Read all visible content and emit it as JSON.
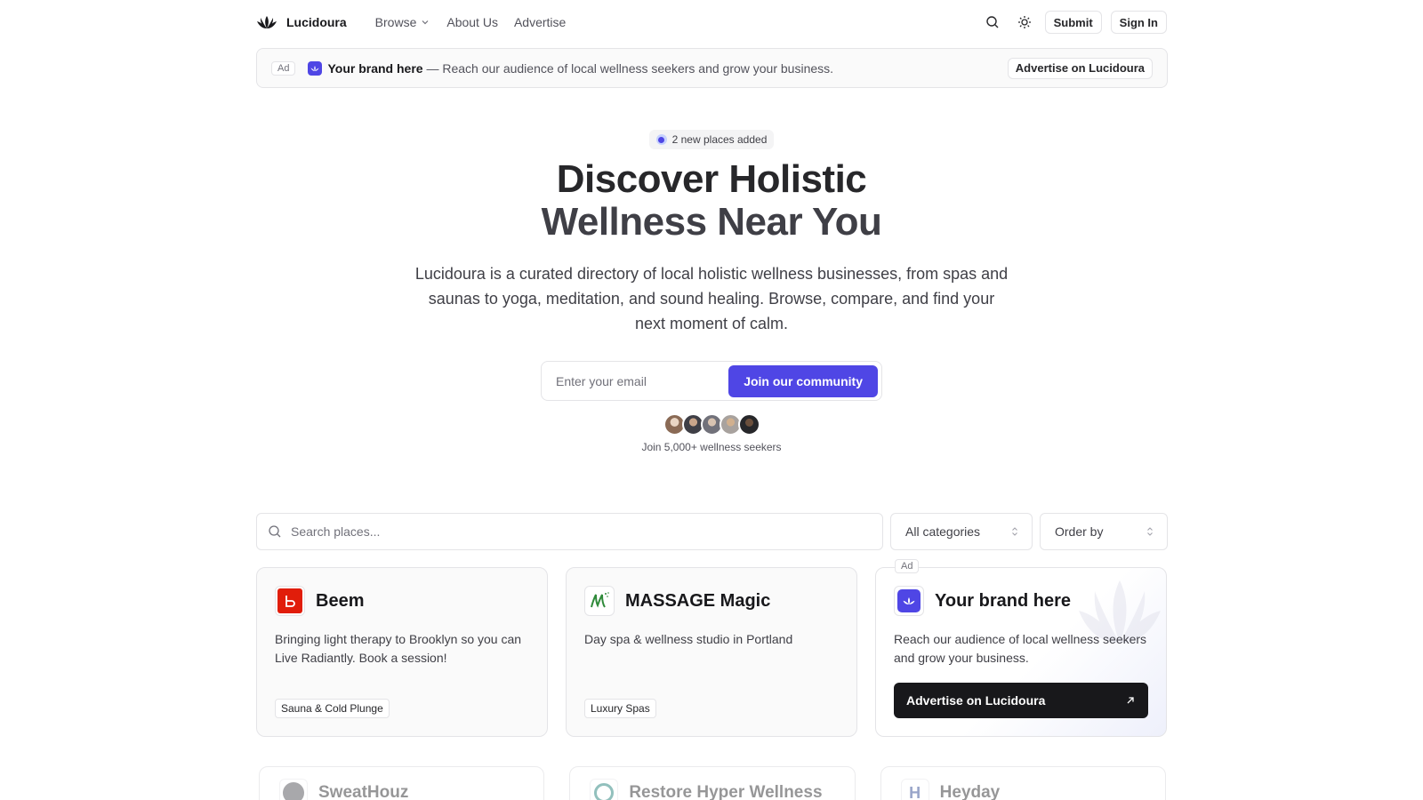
{
  "header": {
    "brand": "Lucidoura",
    "nav": [
      {
        "label": "Browse"
      },
      {
        "label": "About Us"
      },
      {
        "label": "Advertise"
      }
    ],
    "submit_label": "Submit",
    "signin_label": "Sign In"
  },
  "top_ad": {
    "tag": "Ad",
    "brand": "Your brand here",
    "text": " — Reach our audience of local wellness seekers and grow your business.",
    "button": "Advertise on Lucidoura"
  },
  "hero": {
    "pill": "2 new places added",
    "title_line1": "Discover Holistic",
    "title_line2": "Wellness Near You",
    "description": "Lucidoura is a curated directory of local holistic wellness businesses, from spas and saunas to yoga, meditation, and sound healing. Browse, compare, and find your next moment of calm.",
    "email_placeholder": "Enter your email",
    "join_button": "Join our community",
    "join_text": "Join 5,000+ wellness seekers"
  },
  "filters": {
    "search_placeholder": "Search places...",
    "category": "All categories",
    "order": "Order by"
  },
  "cards": [
    {
      "name": "Beem",
      "description": "Bringing light therapy to Brooklyn so you can Live Radiantly. Book a session!",
      "tag": "Sauna & Cold Plunge"
    },
    {
      "name": "MASSAGE Magic",
      "description": "Day spa & wellness studio in Portland",
      "tag": "Luxury Spas"
    }
  ],
  "ad_card": {
    "tag": "Ad",
    "name": "Your brand here",
    "description": "Reach our audience of local wellness seekers and grow your business.",
    "button": "Advertise on Lucidoura"
  },
  "cards_row2": [
    {
      "name": "SweatHouz"
    },
    {
      "name": "Restore Hyper Wellness"
    },
    {
      "name": "Heyday"
    }
  ],
  "colors": {
    "accent": "#4f46e5",
    "beem_red": "#e11d0a",
    "dark": "#18181b"
  }
}
